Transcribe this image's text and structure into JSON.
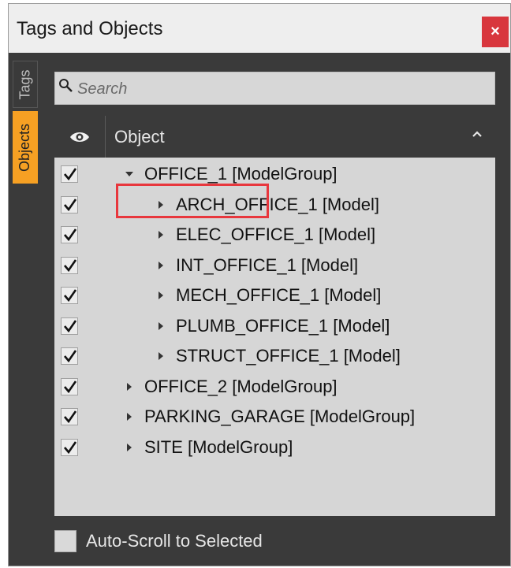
{
  "window": {
    "title": "Tags and Objects",
    "close_label": "×"
  },
  "tabs": {
    "tags": "Tags",
    "objects": "Objects"
  },
  "search": {
    "placeholder": "Search",
    "value": ""
  },
  "tree": {
    "column_header": "Object",
    "rows": [
      {
        "label": "OFFICE_1 [ModelGroup]",
        "checked": true,
        "expanded": true,
        "level": 0
      },
      {
        "label": "ARCH_OFFICE_1 [Model]",
        "checked": true,
        "expanded": false,
        "level": 1,
        "highlighted": true
      },
      {
        "label": "ELEC_OFFICE_1 [Model]",
        "checked": true,
        "expanded": false,
        "level": 1
      },
      {
        "label": "INT_OFFICE_1 [Model]",
        "checked": true,
        "expanded": false,
        "level": 1
      },
      {
        "label": "MECH_OFFICE_1 [Model]",
        "checked": true,
        "expanded": false,
        "level": 1
      },
      {
        "label": "PLUMB_OFFICE_1 [Model]",
        "checked": true,
        "expanded": false,
        "level": 1
      },
      {
        "label": "STRUCT_OFFICE_1 [Model]",
        "checked": true,
        "expanded": false,
        "level": 1
      },
      {
        "label": "OFFICE_2 [ModelGroup]",
        "checked": true,
        "expanded": false,
        "level": 0
      },
      {
        "label": "PARKING_GARAGE [ModelGroup]",
        "checked": true,
        "expanded": false,
        "level": 0
      },
      {
        "label": "SITE [ModelGroup]",
        "checked": true,
        "expanded": false,
        "level": 0
      }
    ]
  },
  "footer": {
    "auto_scroll_label": "Auto-Scroll to Selected",
    "auto_scroll_checked": false
  },
  "colors": {
    "accent_tab": "#f6a023",
    "close_button": "#d8363d",
    "highlight_box": "#e8373d",
    "panel_dark": "#3a3a3a"
  },
  "icons": {
    "eye": "eye-icon",
    "search": "search-icon",
    "sort": "chevron-up-icon",
    "check": "check-icon",
    "expand": "triangle-right-icon",
    "collapse": "triangle-down-icon"
  }
}
